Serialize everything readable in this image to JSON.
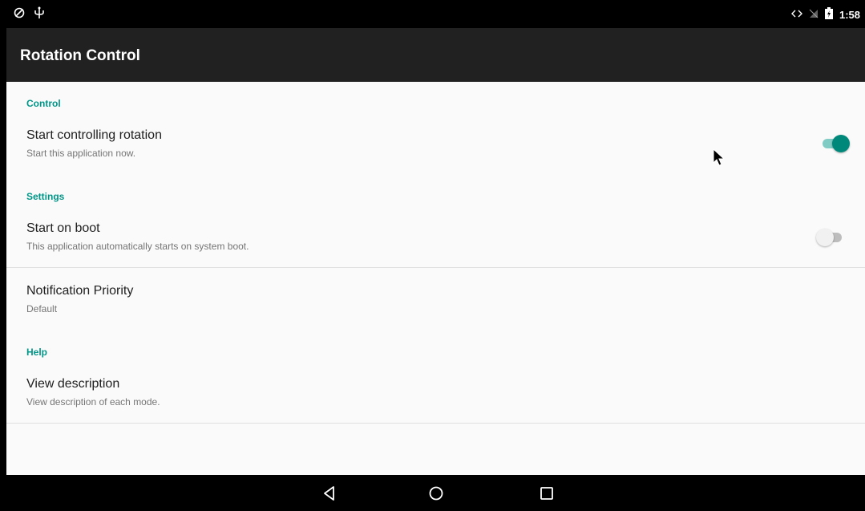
{
  "status_bar": {
    "time": "1:58",
    "left_icons": [
      "sync-icon",
      "usb-icon"
    ],
    "right_icons": [
      "data-arrows-icon",
      "no-signal-icon",
      "battery-icon"
    ]
  },
  "app_bar": {
    "title": "Rotation Control"
  },
  "sections": {
    "control": {
      "header": "Control",
      "items": [
        {
          "title": "Start controlling rotation",
          "summary": "Start this application now.",
          "switch_on": true
        }
      ]
    },
    "settings": {
      "header": "Settings",
      "items": [
        {
          "title": "Start on boot",
          "summary": "This application automatically starts on system boot.",
          "switch_on": false
        },
        {
          "title": "Notification Priority",
          "summary": "Default"
        }
      ]
    },
    "help": {
      "header": "Help",
      "items": [
        {
          "title": "View description",
          "summary": "View description of each mode."
        }
      ]
    }
  },
  "nav_bar": {
    "buttons": [
      "back-icon",
      "home-icon",
      "recents-icon"
    ]
  },
  "colors": {
    "accent": "#009688",
    "switch_on_thumb": "#00897b",
    "app_bar": "#212121",
    "status_bar": "#000000",
    "background": "#fafafa"
  }
}
